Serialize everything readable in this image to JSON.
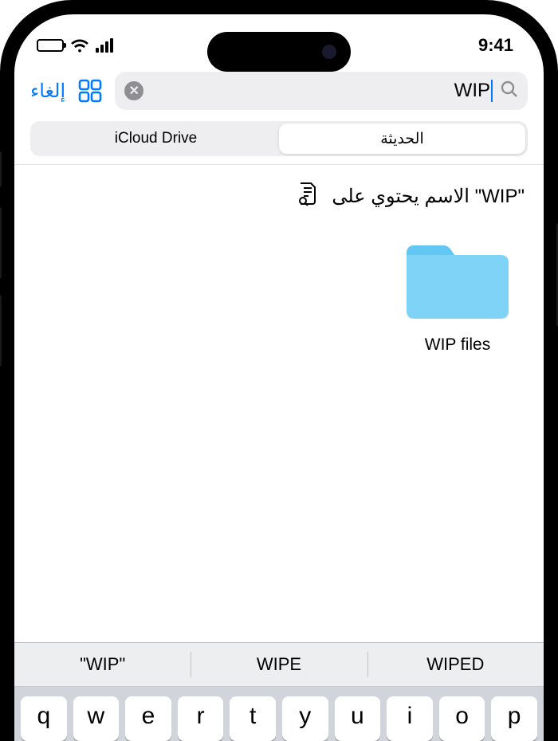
{
  "status": {
    "time": "9:41"
  },
  "nav": {
    "cancel_label": "إلغاء",
    "search_value": "WIP"
  },
  "segments": {
    "left": "iCloud Drive",
    "right": "الحديثة"
  },
  "suggestion": {
    "text": "الاسم يحتوي على \"WIP\""
  },
  "results": [
    {
      "label": "WIP files"
    }
  ],
  "predictive": [
    "\"WIP\"",
    "WIPE",
    "WIPED"
  ],
  "keyboard_row": [
    "q",
    "w",
    "e",
    "r",
    "t",
    "y",
    "u",
    "i",
    "o",
    "p"
  ]
}
